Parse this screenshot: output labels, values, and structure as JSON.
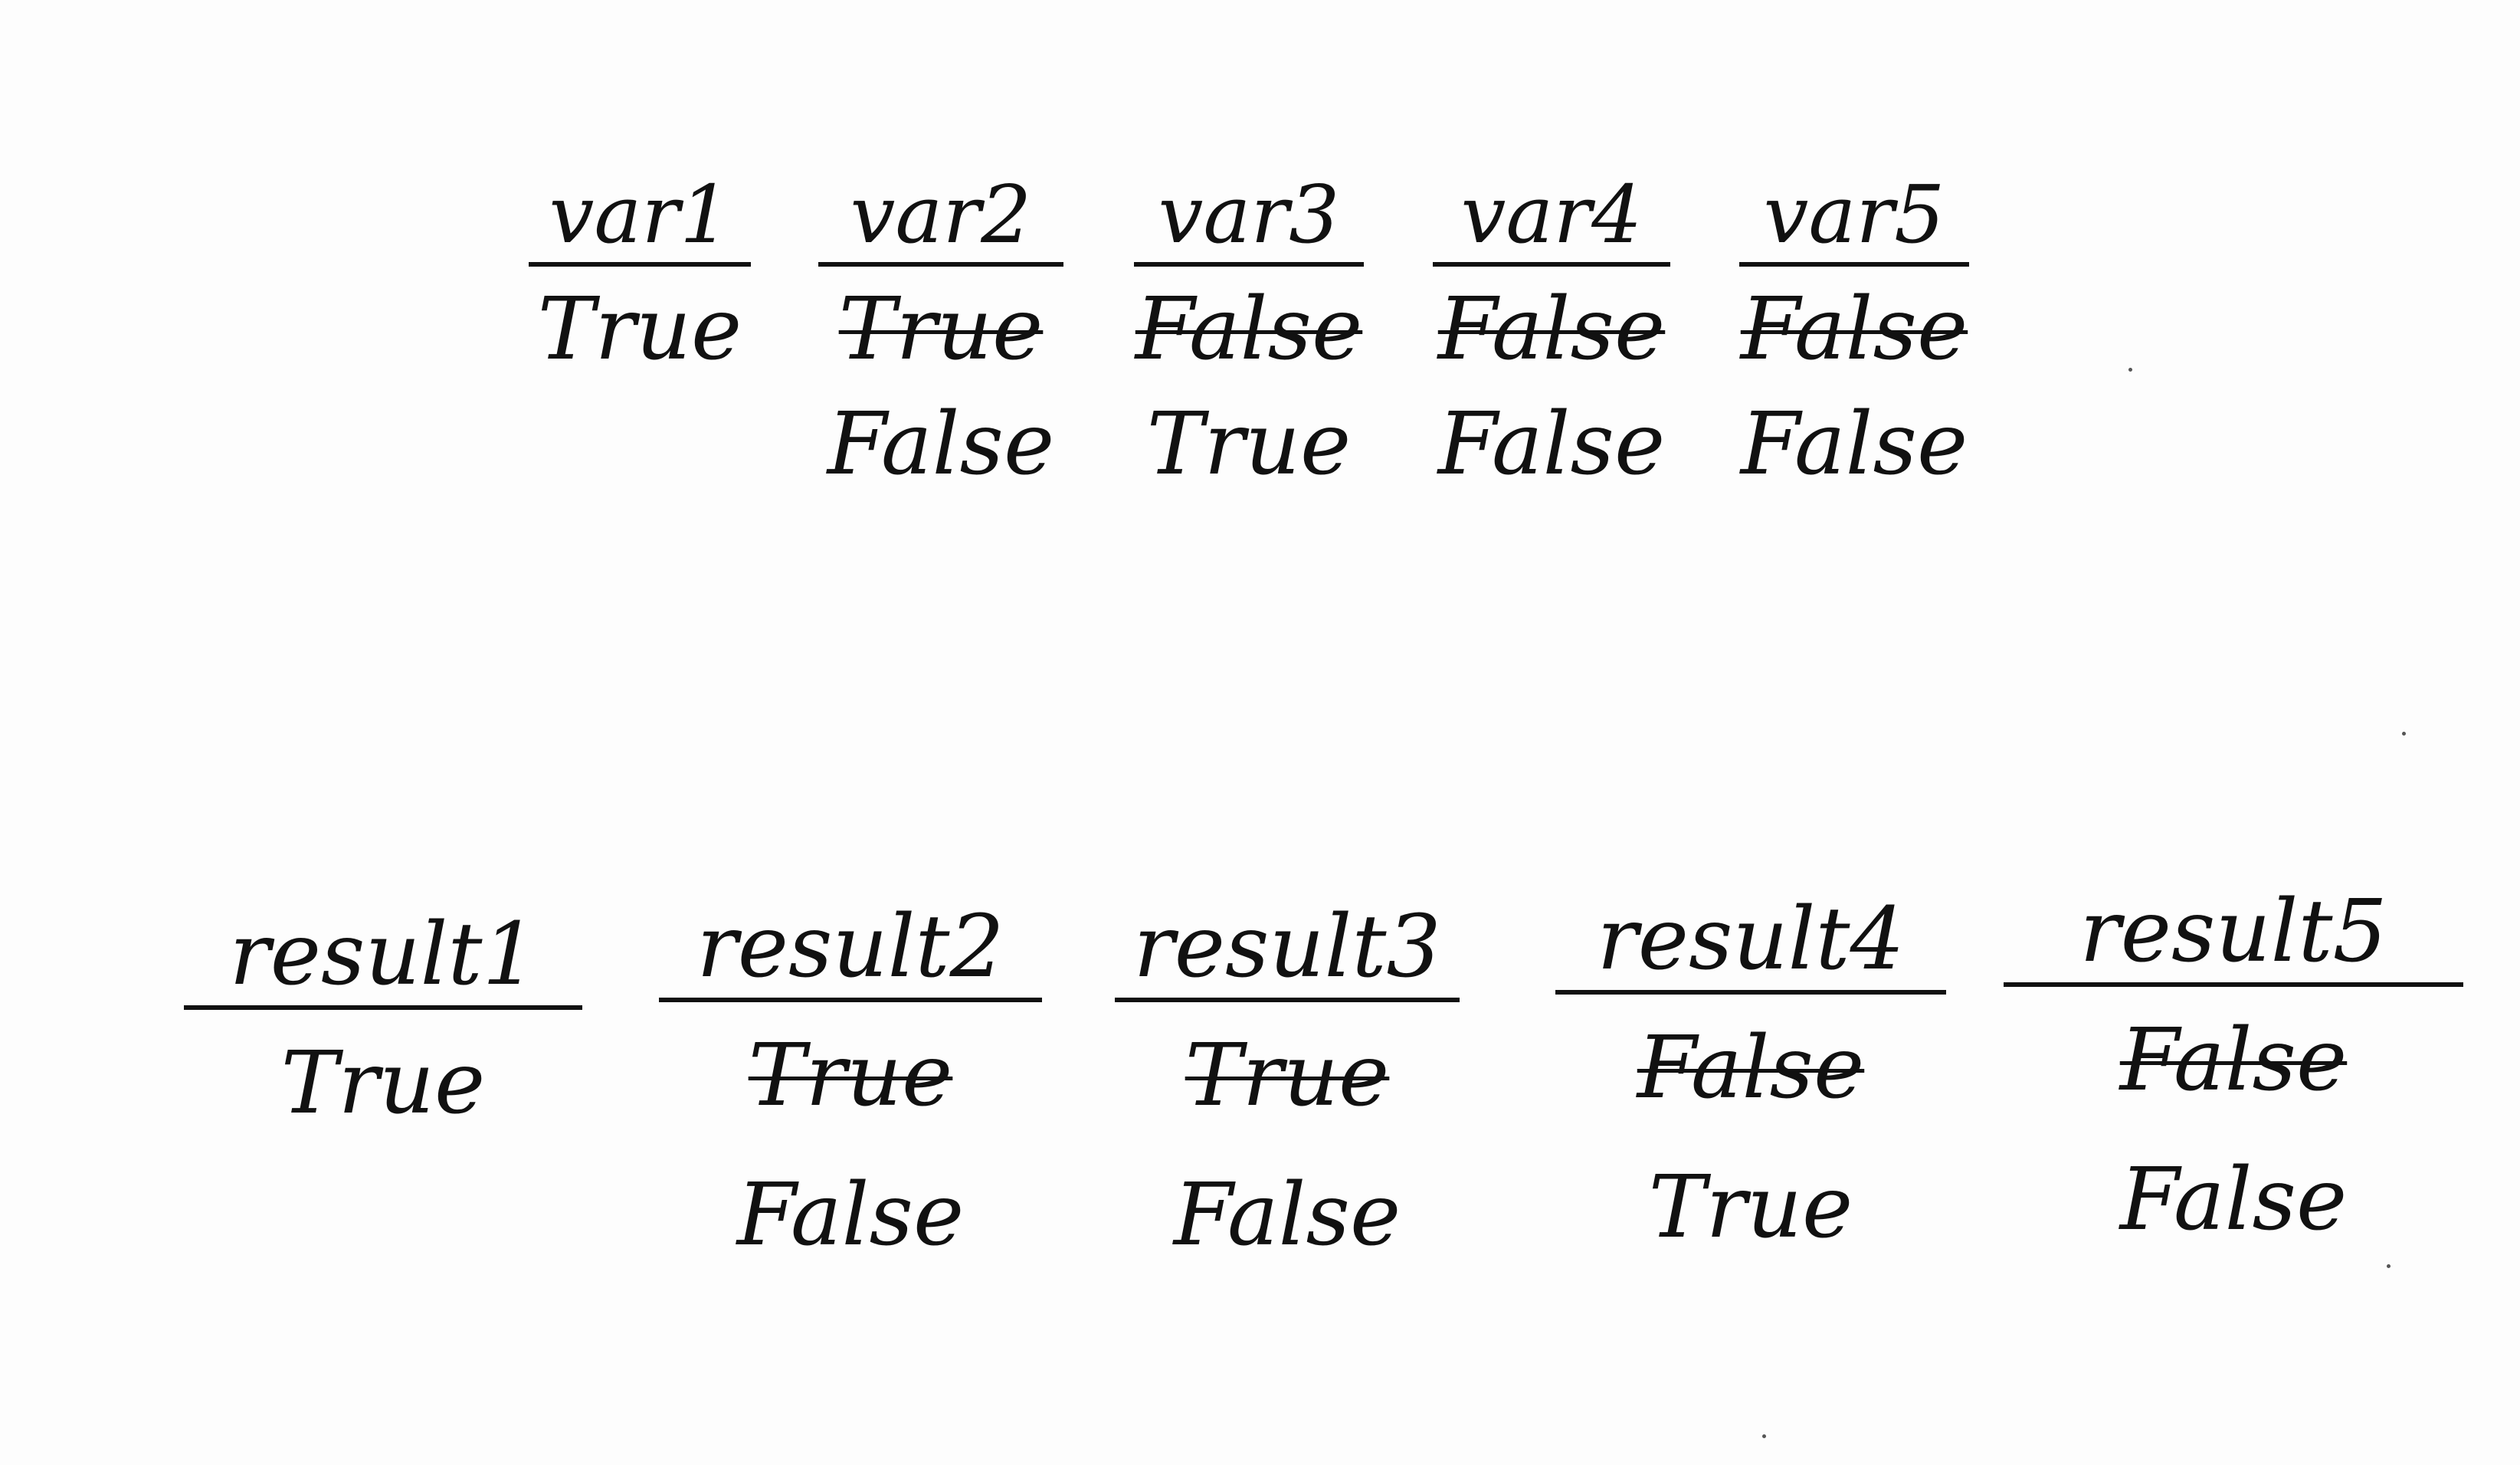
{
  "variables": [
    {
      "name": "var1",
      "values": [
        {
          "text": "True",
          "struck": false
        }
      ]
    },
    {
      "name": "var2",
      "values": [
        {
          "text": "True",
          "struck": true
        },
        {
          "text": "False",
          "struck": false
        }
      ]
    },
    {
      "name": "var3",
      "values": [
        {
          "text": "False",
          "struck": true
        },
        {
          "text": "True",
          "struck": false
        }
      ]
    },
    {
      "name": "var4",
      "values": [
        {
          "text": "False",
          "struck": true
        },
        {
          "text": "False",
          "struck": false
        }
      ]
    },
    {
      "name": "var5",
      "values": [
        {
          "text": "False",
          "struck": true
        },
        {
          "text": "False",
          "struck": false
        }
      ]
    }
  ],
  "results": [
    {
      "name": "result1",
      "values": [
        {
          "text": "True",
          "struck": false
        }
      ]
    },
    {
      "name": "result2",
      "values": [
        {
          "text": "True",
          "struck": true
        },
        {
          "text": "False",
          "struck": false
        }
      ]
    },
    {
      "name": "result3",
      "values": [
        {
          "text": "True",
          "struck": true
        },
        {
          "text": "False",
          "struck": false
        }
      ]
    },
    {
      "name": "result4",
      "values": [
        {
          "text": "False",
          "struck": true
        },
        {
          "text": "True",
          "struck": false
        }
      ]
    },
    {
      "name": "result5",
      "values": [
        {
          "text": "False",
          "struck": true
        },
        {
          "text": "False",
          "struck": false
        }
      ]
    }
  ]
}
